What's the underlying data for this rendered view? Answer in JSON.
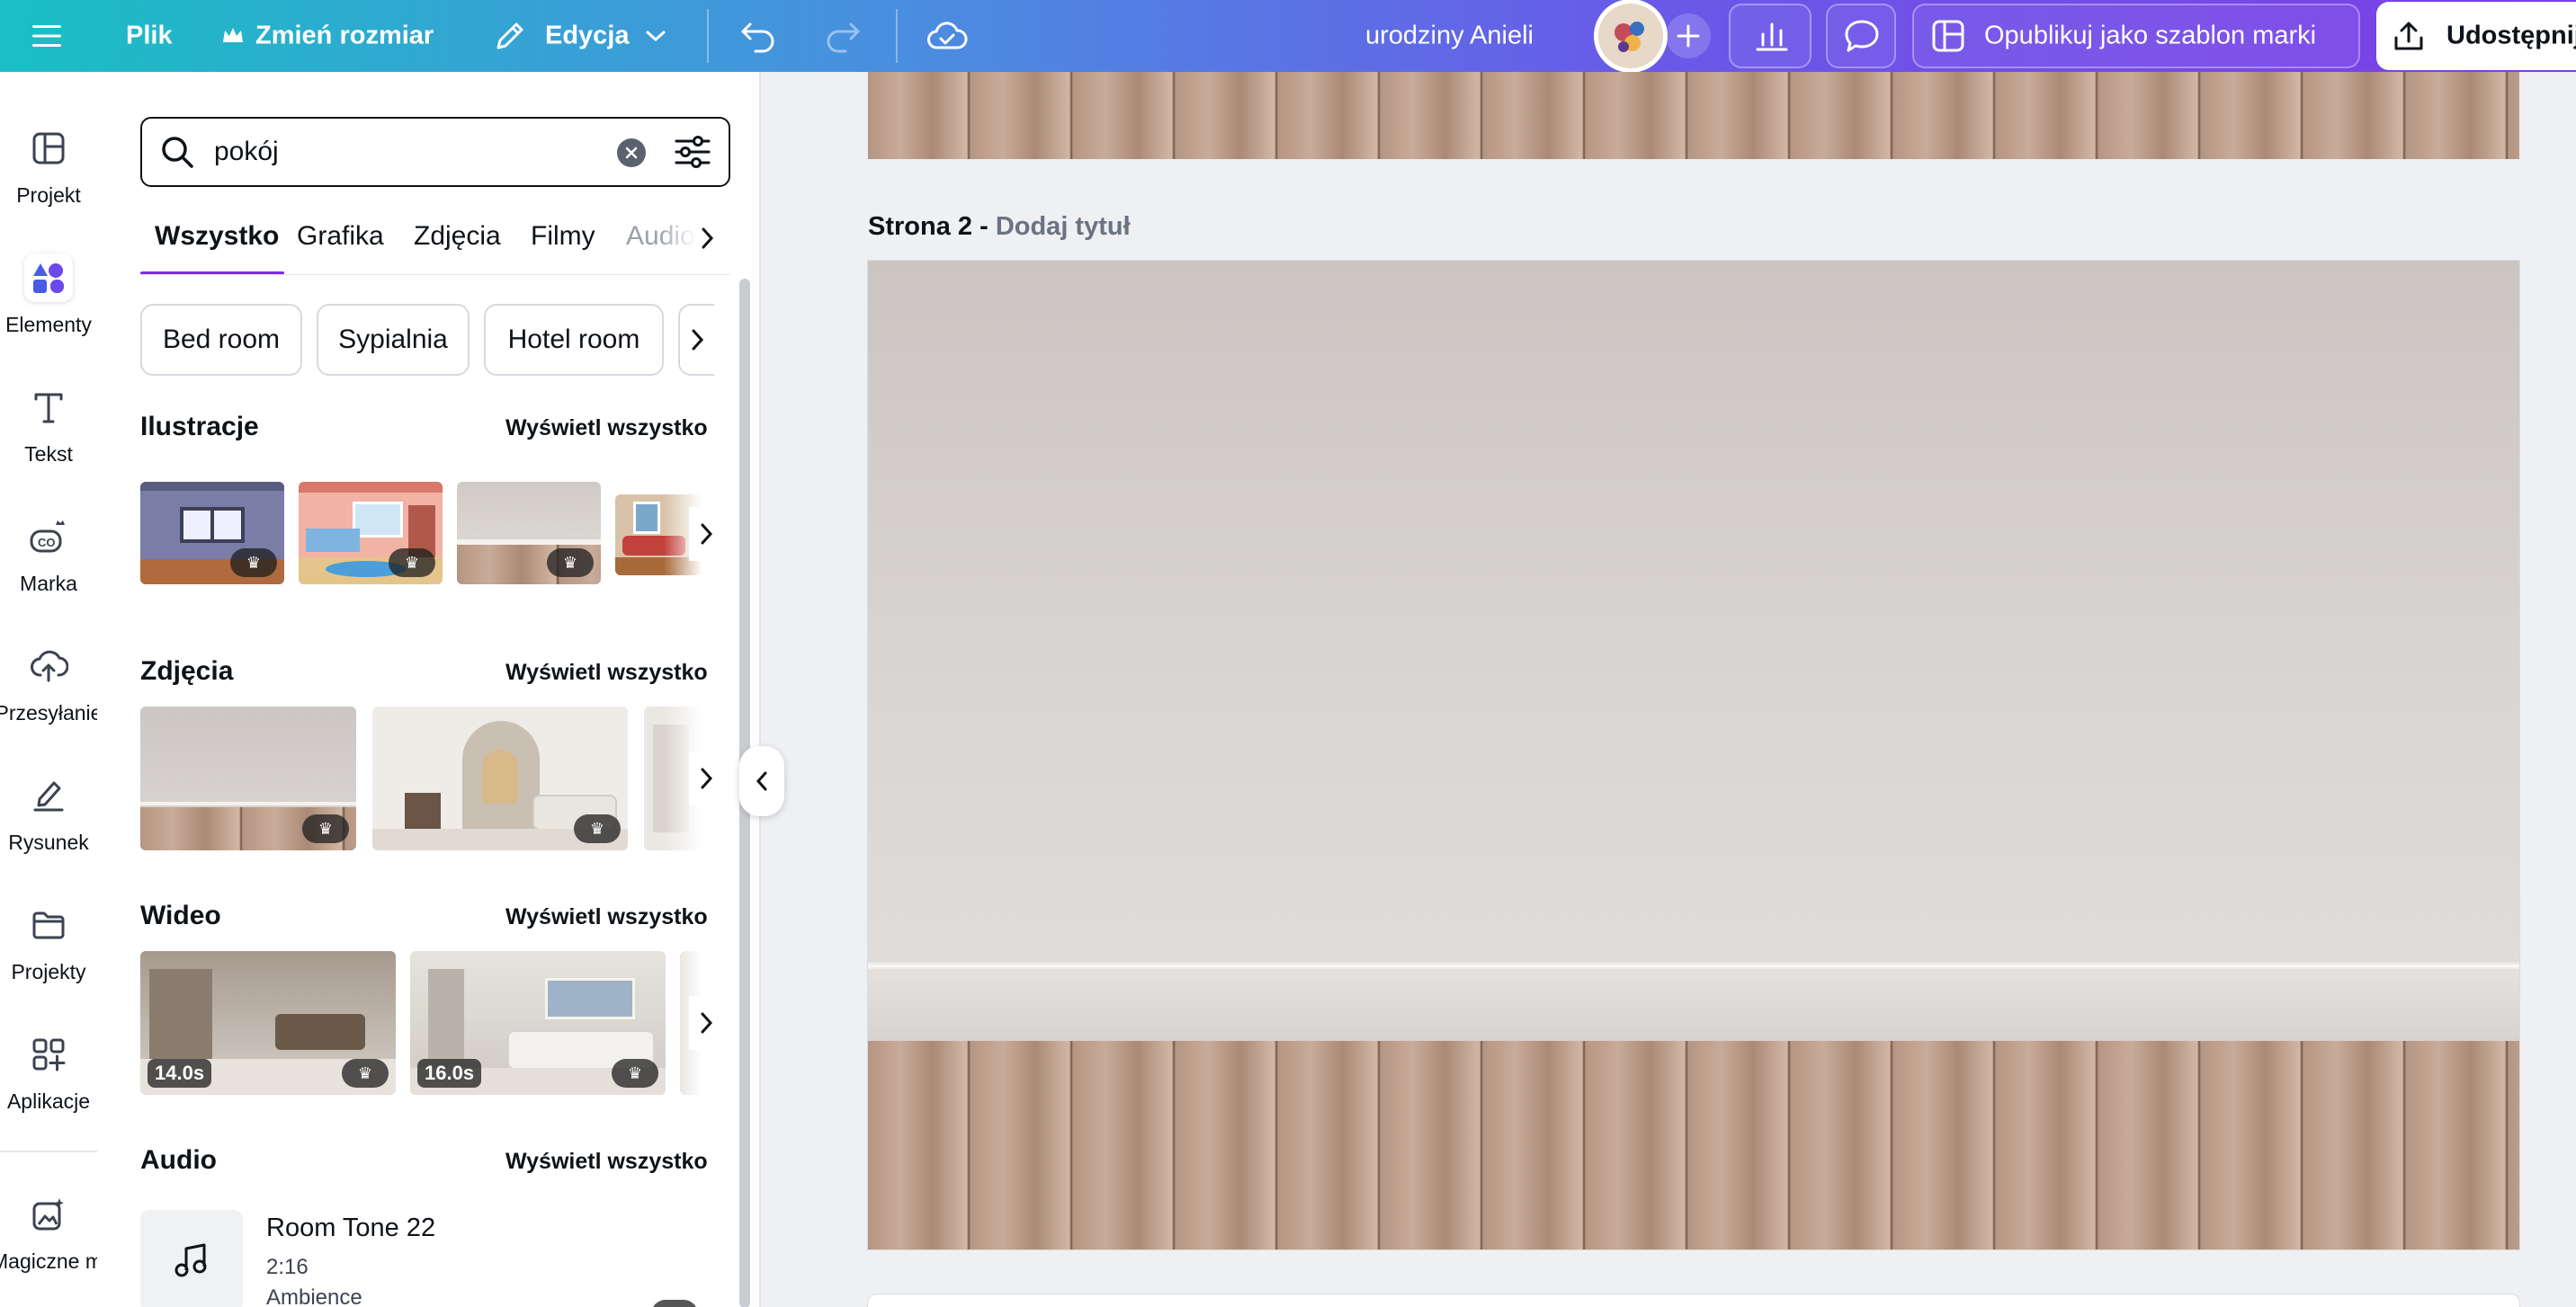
{
  "topbar": {
    "menu_icon": "hamburger-icon",
    "file_label": "Plik",
    "resize_label": "Zmień rozmiar",
    "edit_label": "Edycja",
    "doc_title": "urodziny Anieli",
    "publish_label": "Opublikuj jako szablon marki",
    "share_label": "Udostępnij"
  },
  "rail": {
    "items": [
      {
        "label": "Projekt",
        "icon": "project-icon"
      },
      {
        "label": "Elementy",
        "icon": "elements-icon"
      },
      {
        "label": "Tekst",
        "icon": "text-icon"
      },
      {
        "label": "Marka",
        "icon": "brand-icon"
      },
      {
        "label": "Przesyłanie",
        "icon": "upload-icon"
      },
      {
        "label": "Rysunek",
        "icon": "draw-icon"
      },
      {
        "label": "Projekty",
        "icon": "folder-icon"
      },
      {
        "label": "Aplikacje",
        "icon": "apps-icon"
      },
      {
        "label": "Magiczne m...",
        "icon": "magic-icon"
      }
    ]
  },
  "panel": {
    "search_value": "pokój",
    "tabs": [
      "Wszystko",
      "Grafika",
      "Zdjęcia",
      "Filmy",
      "Audio"
    ],
    "chips": [
      "Bed room",
      "Sypialnia",
      "Hotel room"
    ],
    "see_all": "Wyświetl wszystko",
    "sections": {
      "illustrations": "Ilustracje",
      "photos": "Zdjęcia",
      "video": "Wideo",
      "audio": "Audio"
    },
    "videos": [
      {
        "duration": "14.0s"
      },
      {
        "duration": "16.0s"
      }
    ],
    "audio_item": {
      "title": "Room Tone 22",
      "length": "2:16",
      "genre": "Ambience"
    }
  },
  "canvas": {
    "page_label": "Strona 2 -",
    "page_title_placeholder": "Dodaj tytuł"
  },
  "colors": {
    "accent": "#7d2ae8",
    "topbar_start": "#19bfc4",
    "topbar_end": "#7d3ee6"
  }
}
